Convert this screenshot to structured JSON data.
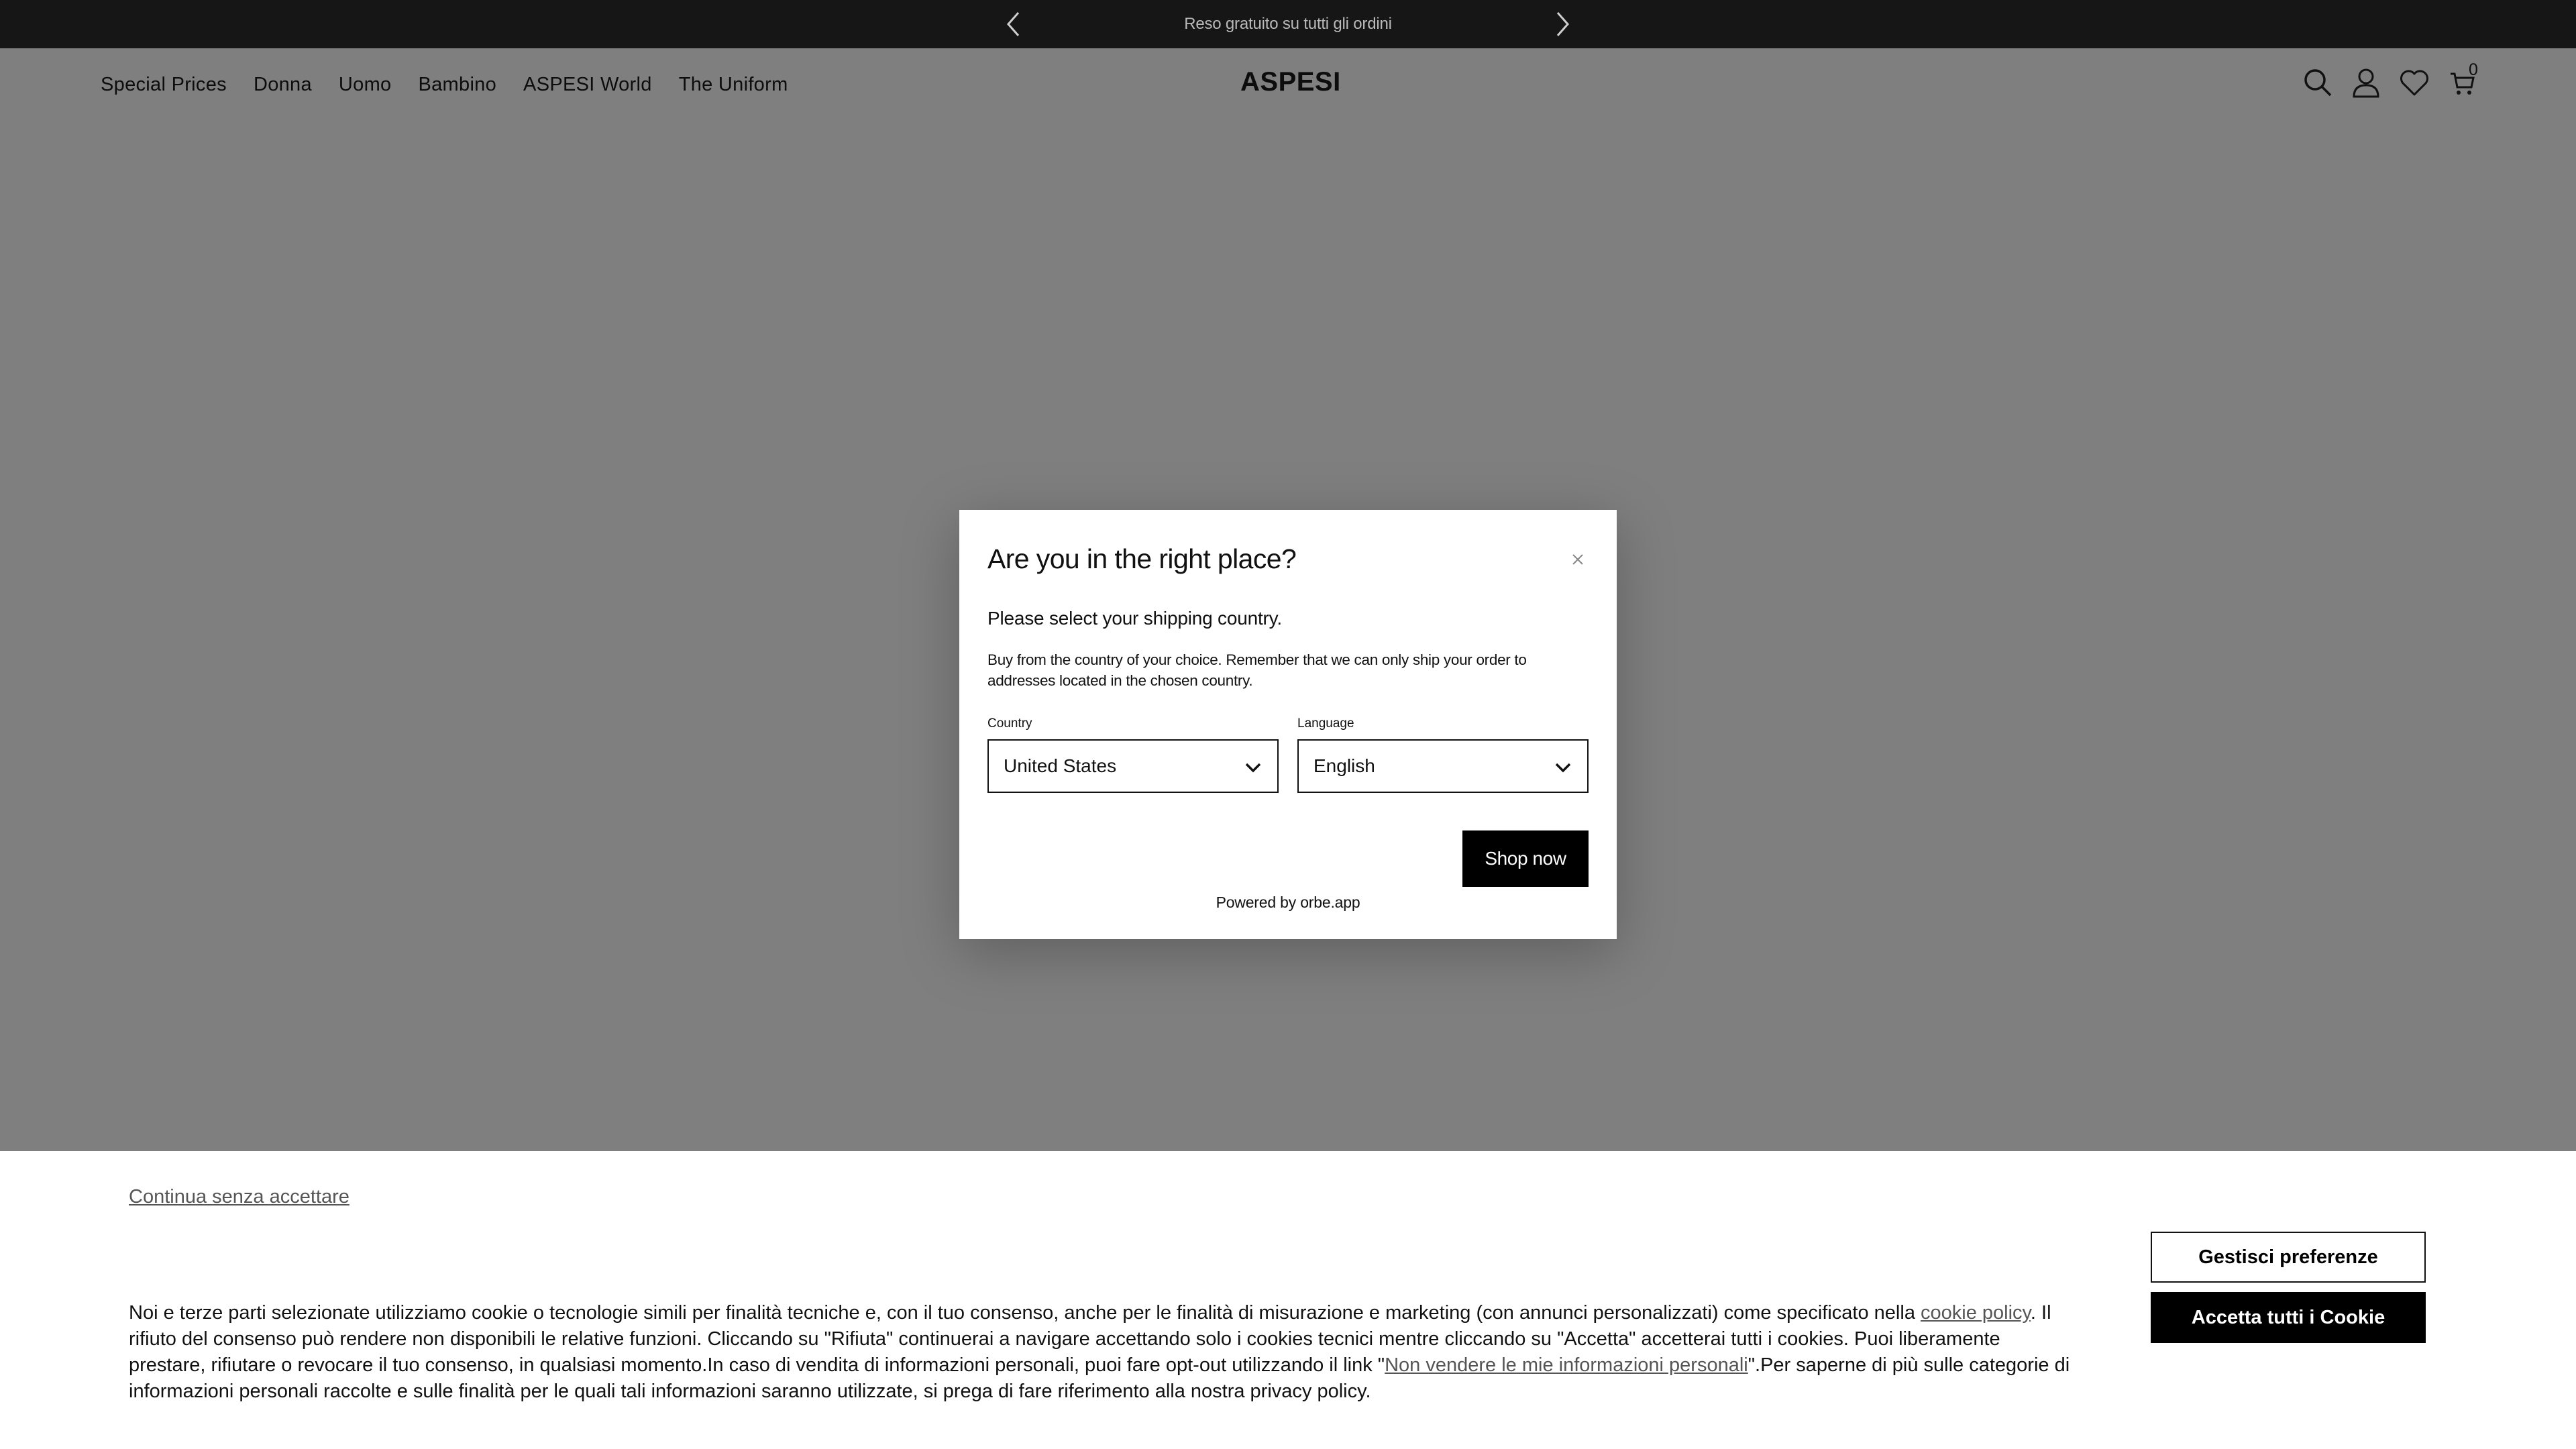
{
  "announcement": {
    "message": "Reso gratuito su tutti gli ordini",
    "prev_icon": "chevron-left-icon",
    "next_icon": "chevron-right-icon"
  },
  "header": {
    "logo": "ASPESI",
    "nav": [
      {
        "label": "Special Prices"
      },
      {
        "label": "Donna"
      },
      {
        "label": "Uomo"
      },
      {
        "label": "Bambino"
      },
      {
        "label": "ASPESI World"
      },
      {
        "label": "The Uniform"
      }
    ],
    "icons": [
      "search-icon",
      "account-icon",
      "heart-icon",
      "cart-icon"
    ],
    "cart_count": "0"
  },
  "modal": {
    "title": "Are you in the right place?",
    "subtitle": "Please select your shipping country.",
    "description": "Buy from the country of your choice. Remember that we can only ship your order to addresses located in the chosen country.",
    "country_label": "Country",
    "country_value": "United States",
    "language_label": "Language",
    "language_value": "English",
    "shop_button": "Shop now",
    "powered_by": "Powered by orbe.app"
  },
  "cookie_banner": {
    "skip_link": "Continua senza accettare",
    "text_part1": "Noi e terze parti selezionate utilizziamo cookie o tecnologie simili per finalità tecniche e, con il tuo consenso, anche per le finalità di misurazione e marketing (con annunci personalizzati) come specificato nella ",
    "cookie_policy_link": "cookie policy",
    "text_part2": ". Il rifiuto del consenso può rendere non disponibili le relative funzioni. Cliccando su \"Rifiuta\" continuerai a navigare accettando solo i cookies tecnici mentre cliccando su \"Accetta\" accetterai tutti i cookies. Puoi liberamente prestare, rifiutare o revocare il tuo consenso, in qualsiasi momento.In caso di vendita di informazioni personali, puoi fare opt-out utilizzando il link \"",
    "do_not_sell_link": "Non vendere le mie informazioni personali",
    "text_part3": "\".Per saperne di più sulle categorie di informazioni personali raccolte e sulle finalità per le quali tali informazioni saranno utilizzate, si prega di fare riferimento alla nostra privacy policy.",
    "preferences_button": "Gestisci preferenze",
    "accept_button": "Accetta tutti i Cookie"
  },
  "colors": {
    "overlay": "#7f7f7f",
    "topbar": "#161616",
    "accent": "#000000"
  }
}
